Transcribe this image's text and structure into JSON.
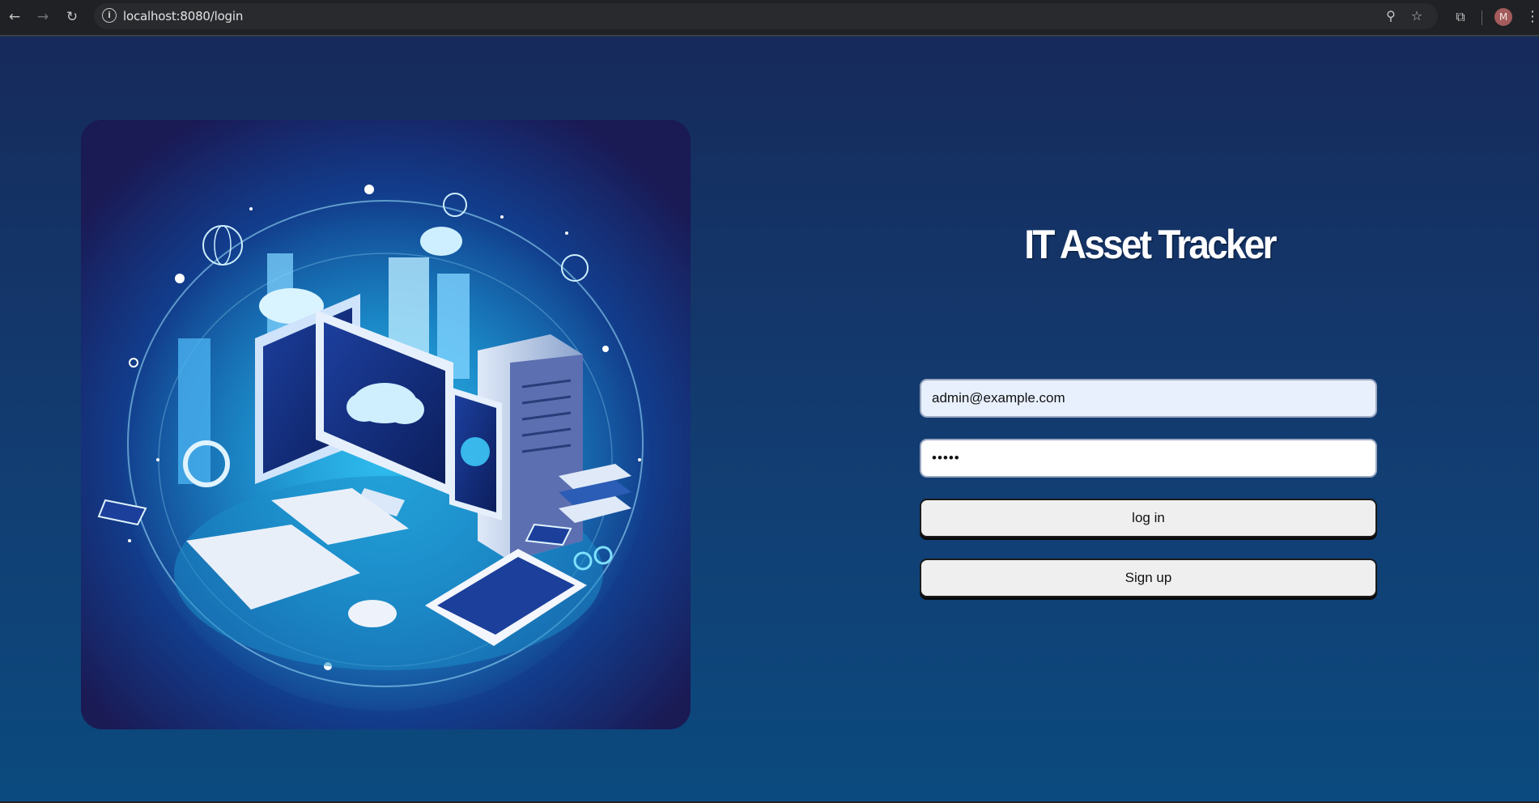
{
  "browser": {
    "url": "localhost:8080/login",
    "avatar_initial": "M",
    "icons": {
      "back": "arrow-left-icon",
      "forward": "arrow-right-icon",
      "reload": "reload-icon",
      "site_info": "info-icon",
      "zoom": "zoom-icon",
      "bookmark": "star-icon",
      "extensions": "puzzle-icon",
      "menu": "kebab-icon"
    }
  },
  "login": {
    "title": "IT Asset Tracker",
    "email_value": "admin@example.com",
    "password_value": "•••••",
    "login_label": "log in",
    "signup_label": "Sign up"
  },
  "colors": {
    "page_top": "#162a5b",
    "page_bottom": "#0b4a7e",
    "button_bg": "#efefef",
    "autofill_bg": "#e8f0fe"
  }
}
